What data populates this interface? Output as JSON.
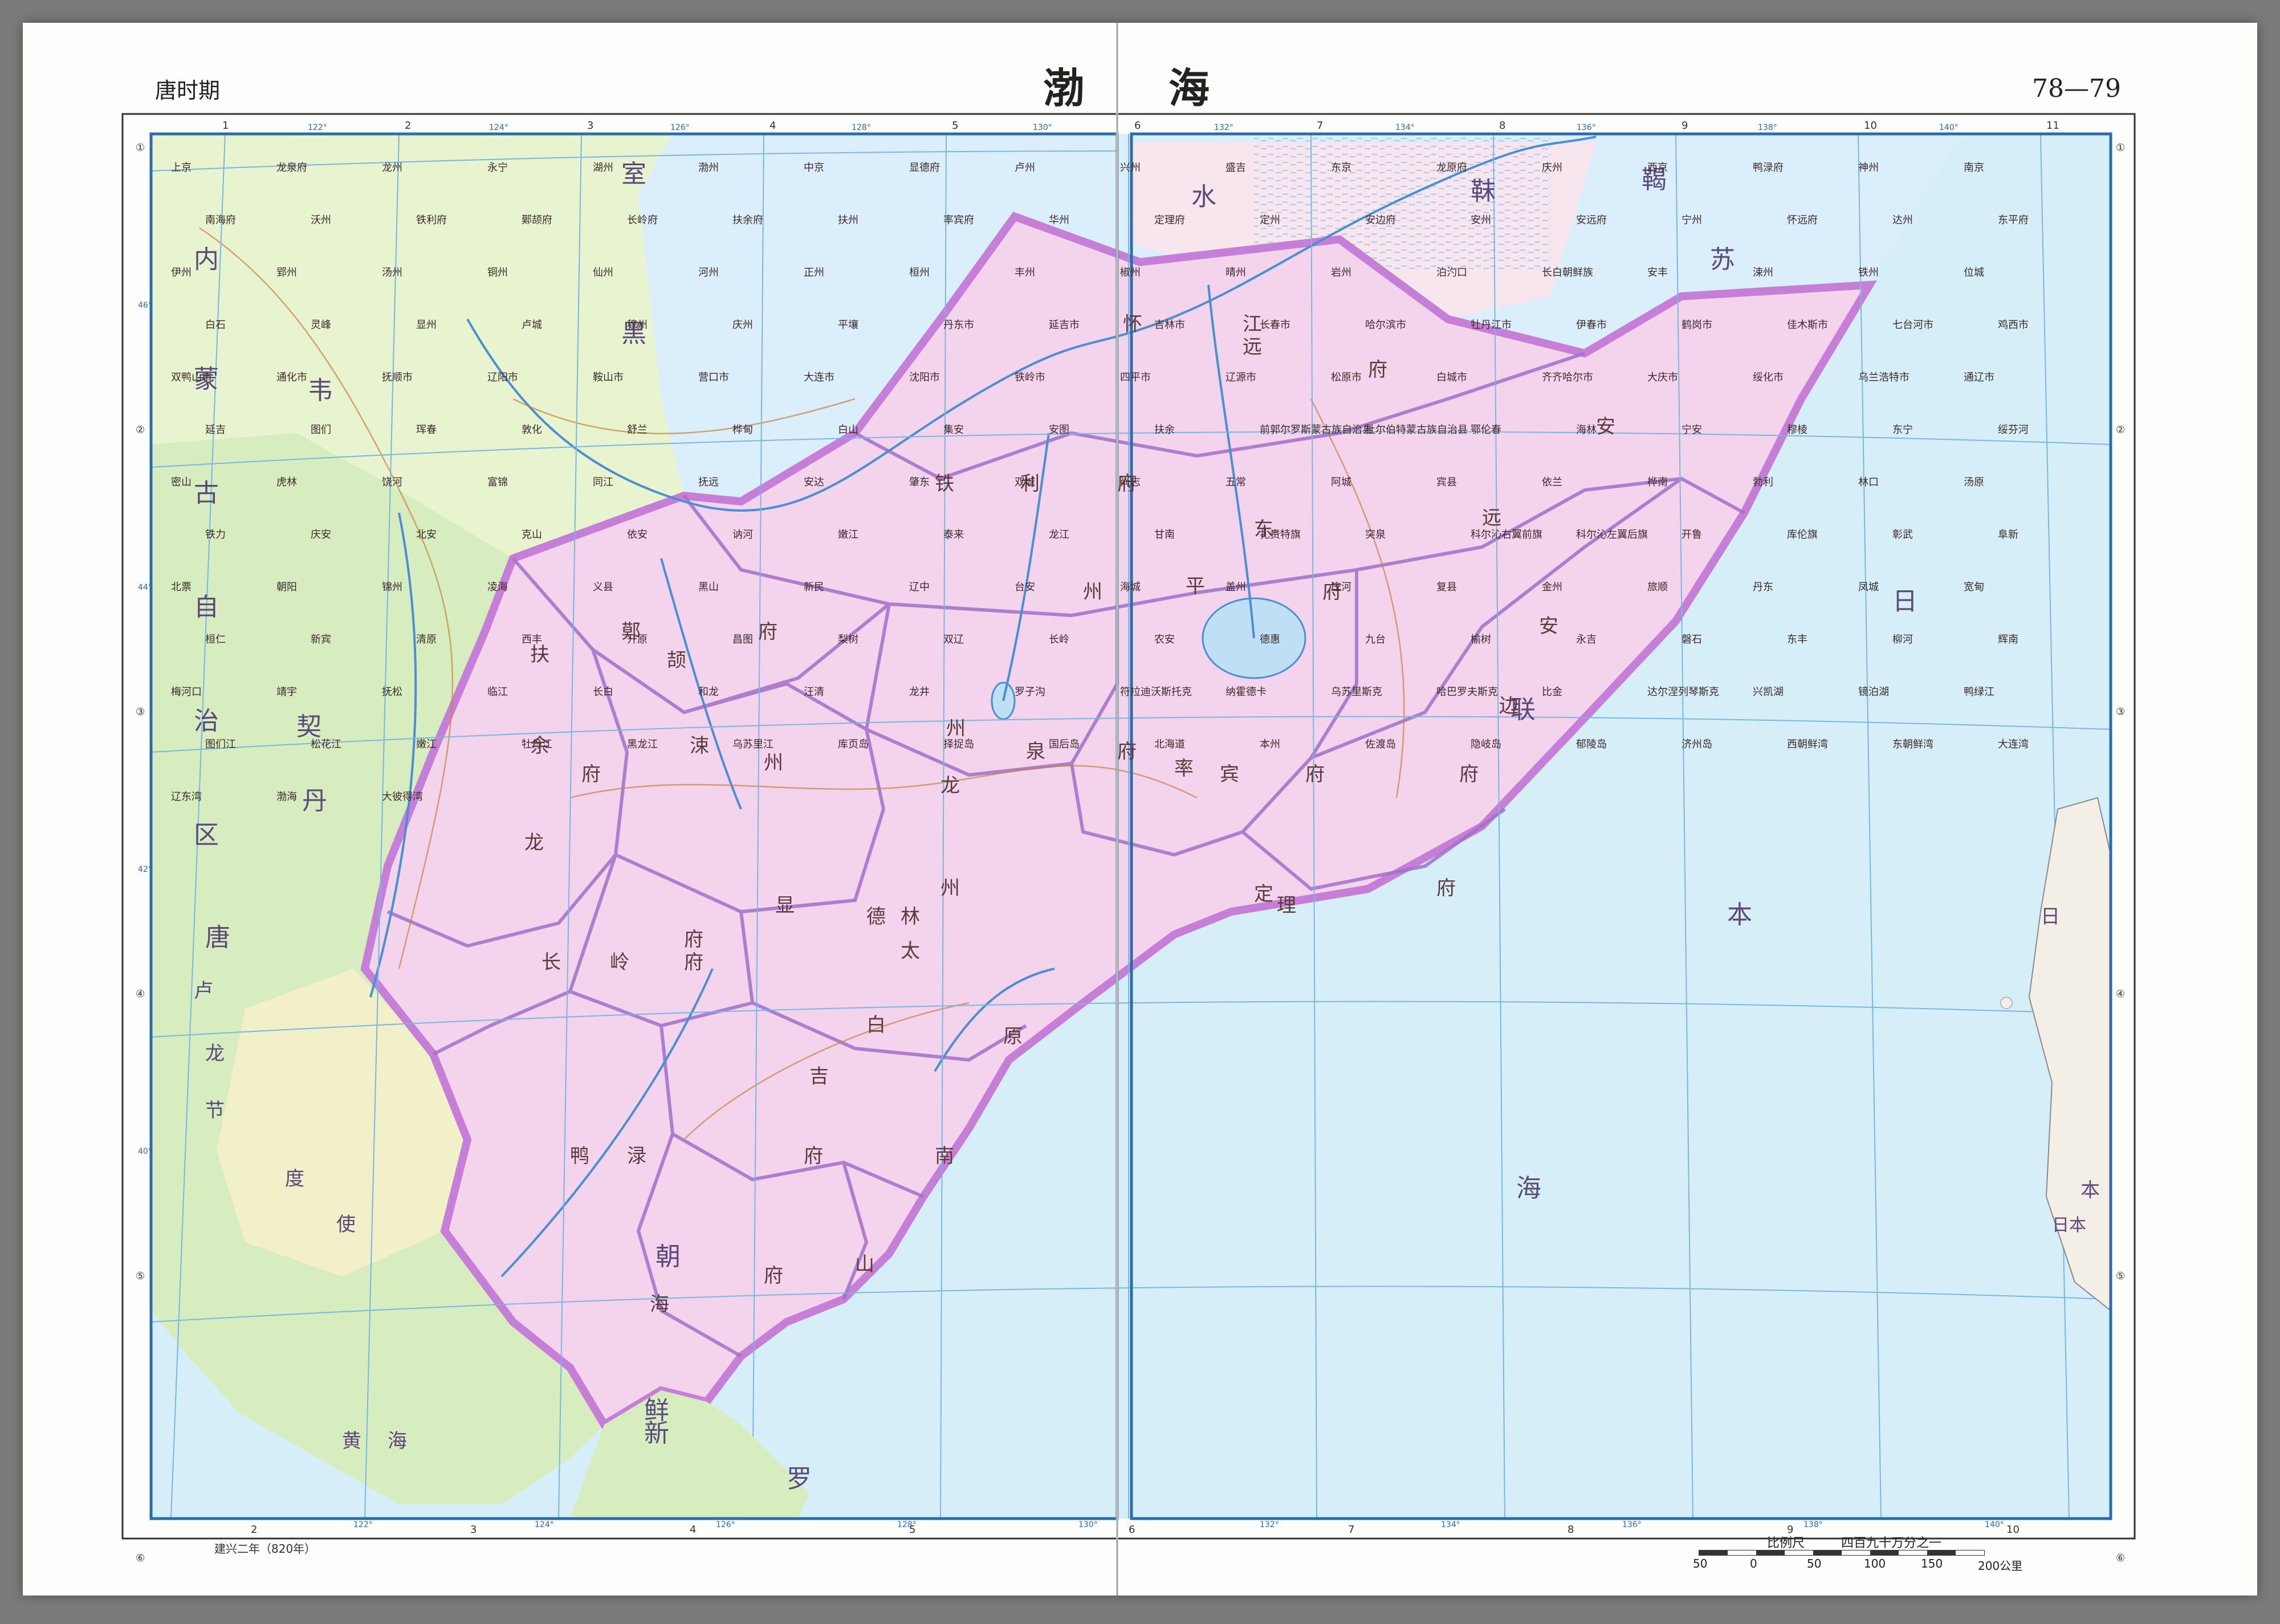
{
  "header": {
    "era": "唐时期",
    "title_left": "渤",
    "title_right": "海",
    "page": "78—79"
  },
  "footnote": "建兴二年（820年）",
  "scale": {
    "title": "比例尺",
    "ratio": "四百九十万分之一",
    "ticks": [
      "50",
      "0",
      "50",
      "100",
      "150",
      "200公里"
    ]
  },
  "grid": {
    "top_numbers": [
      "1",
      "2",
      "3",
      "4",
      "5",
      "6",
      "7",
      "8",
      "9",
      "10",
      "11"
    ],
    "bottom_numbers": [
      "2",
      "3",
      "4",
      "5",
      "6",
      "7",
      "8",
      "9",
      "10"
    ],
    "side_numbers": [
      "①",
      "②",
      "③",
      "④",
      "⑤",
      "⑥"
    ],
    "longitudes": [
      "122°",
      "124°",
      "126°",
      "128°",
      "130°",
      "132°",
      "134°",
      "136°",
      "138°",
      "140°"
    ],
    "latitudes": [
      "46°",
      "44°",
      "42°",
      "40°"
    ]
  },
  "regions": [
    {
      "name": "室",
      "kind": "big"
    },
    {
      "name": "韦",
      "kind": "big"
    },
    {
      "name": "黑",
      "kind": "big"
    },
    {
      "name": "水",
      "kind": "big"
    },
    {
      "name": "靺",
      "kind": "big"
    },
    {
      "name": "鞨",
      "kind": "big"
    },
    {
      "name": "内",
      "kind": "big"
    },
    {
      "name": "蒙",
      "kind": "big"
    },
    {
      "name": "古",
      "kind": "big"
    },
    {
      "name": "自",
      "kind": "big"
    },
    {
      "name": "治",
      "kind": "big"
    },
    {
      "name": "区",
      "kind": "big"
    },
    {
      "name": "契",
      "kind": "big"
    },
    {
      "name": "丹",
      "kind": "big"
    },
    {
      "name": "唐",
      "kind": "big"
    },
    {
      "name": "苏",
      "kind": "big"
    },
    {
      "name": "联",
      "kind": "big"
    },
    {
      "name": "日",
      "kind": "big"
    },
    {
      "name": "本",
      "kind": "big"
    },
    {
      "name": "海",
      "kind": "big"
    },
    {
      "name": "朝",
      "kind": "big"
    },
    {
      "name": "鲜",
      "kind": "big"
    },
    {
      "name": "新",
      "kind": "big"
    },
    {
      "name": "罗",
      "kind": "big"
    },
    {
      "name": "黄",
      "kind": "mid"
    },
    {
      "name": "海",
      "kind": "mid"
    },
    {
      "name": "卢",
      "kind": "mid"
    },
    {
      "name": "龙",
      "kind": "mid"
    },
    {
      "name": "节",
      "kind": "mid"
    },
    {
      "name": "度",
      "kind": "mid"
    },
    {
      "name": "使",
      "kind": "mid"
    },
    {
      "name": "日",
      "kind": "mid"
    },
    {
      "name": "本",
      "kind": "mid"
    },
    {
      "name": "日本",
      "kind": "small"
    }
  ],
  "prefectures": [
    "怀",
    "江",
    "远",
    "府",
    "安",
    "铁",
    "利",
    "府",
    "东",
    "平",
    "府",
    "远",
    "安",
    "边",
    "府",
    "鄚",
    "颉",
    "府",
    "州",
    "扶",
    "余",
    "府",
    "涑",
    "州",
    "龙",
    "泉",
    "府",
    "率",
    "宾",
    "府",
    "定",
    "理",
    "府",
    "显",
    "德",
    "府",
    "长",
    "岭",
    "府",
    "林",
    "太",
    "白",
    "原",
    "鸭",
    "渌",
    "府",
    "南",
    "海",
    "府",
    "山",
    "吉",
    "龙",
    "州",
    "州"
  ],
  "places": [
    "上京",
    "龙泉府",
    "龙州",
    "永宁",
    "湖州",
    "渤州",
    "中京",
    "显德府",
    "卢州",
    "兴州",
    "盛吉",
    "东京",
    "龙原府",
    "庆州",
    "西京",
    "鸭渌府",
    "神州",
    "南京",
    "南海府",
    "沃州",
    "铁利府",
    "鄚颉府",
    "长岭府",
    "扶余府",
    "扶州",
    "率宾府",
    "华州",
    "定理府",
    "定州",
    "安边府",
    "安州",
    "安远府",
    "宁州",
    "怀远府",
    "达州",
    "东平府",
    "伊州",
    "郢州",
    "汤州",
    "铜州",
    "仙州",
    "河州",
    "正州",
    "桓州",
    "丰州",
    "椒州",
    "晴州",
    "岩州",
    "泊汋口",
    "长白朝鲜族",
    "安丰",
    "涑州",
    "铁州",
    "位城",
    "白石",
    "灵峰",
    "显州",
    "卢城",
    "穆州",
    "庆州",
    "平壤",
    "丹东市",
    "延吉市",
    "吉林市",
    "长春市",
    "哈尔滨市",
    "牡丹江市",
    "伊春市",
    "鹤岗市",
    "佳木斯市",
    "七台河市",
    "鸡西市",
    "双鸭山市",
    "通化市",
    "抚顺市",
    "辽阳市",
    "鞍山市",
    "营口市",
    "大连市",
    "沈阳市",
    "铁岭市",
    "四平市",
    "辽源市",
    "松原市",
    "白城市",
    "齐齐哈尔市",
    "大庆市",
    "绥化市",
    "乌兰浩特市",
    "通辽市",
    "延吉",
    "图们",
    "珲春",
    "敦化",
    "舒兰",
    "桦甸",
    "白山",
    "集安",
    "安图",
    "扶余",
    "前郭尔罗斯蒙古族自治县",
    "杜尔伯特蒙古族自治县",
    "鄂伦春",
    "海林",
    "宁安",
    "穆棱",
    "东宁",
    "绥芬河",
    "密山",
    "虎林",
    "饶河",
    "富锦",
    "同江",
    "抚远",
    "安达",
    "肇东",
    "双城",
    "尚志",
    "五常",
    "阿城",
    "宾县",
    "依兰",
    "桦南",
    "勃利",
    "林口",
    "汤原",
    "铁力",
    "庆安",
    "北安",
    "克山",
    "依安",
    "讷河",
    "嫩江",
    "泰来",
    "龙江",
    "甘南",
    "扎赉特旗",
    "突泉",
    "科尔沁右翼前旗",
    "科尔沁左翼后旗",
    "开鲁",
    "库伦旗",
    "彰武",
    "阜新",
    "北票",
    "朝阳",
    "锦州",
    "凌海",
    "义县",
    "黑山",
    "新民",
    "辽中",
    "台安",
    "海城",
    "盖州",
    "庄河",
    "复县",
    "金州",
    "旅顺",
    "丹东",
    "凤城",
    "宽甸",
    "桓仁",
    "新宾",
    "清原",
    "西丰",
    "开原",
    "昌图",
    "梨树",
    "双辽",
    "长岭",
    "农安",
    "德惠",
    "九台",
    "榆树",
    "永吉",
    "磐石",
    "东丰",
    "柳河",
    "辉南",
    "梅河口",
    "靖宇",
    "抚松",
    "临江",
    "长白",
    "和龙",
    "汪清",
    "龙井",
    "罗子沟",
    "符拉迪沃斯托克",
    "纳霍德卡",
    "乌苏里斯克",
    "哈巴罗夫斯克",
    "比金",
    "达尔涅列琴斯克",
    "兴凯湖",
    "镜泊湖",
    "鸭绿江",
    "图们江",
    "松花江",
    "嫩江",
    "牡丹江",
    "黑龙江",
    "乌苏里江",
    "库页岛",
    "择捉岛",
    "国后岛",
    "北海道",
    "本州",
    "佐渡岛",
    "隐岐岛",
    "郁陵岛",
    "济州岛",
    "西朝鲜湾",
    "东朝鲜湾",
    "大连湾",
    "辽东湾",
    "渤海",
    "大彼得湾"
  ],
  "map_colors": {
    "balhae_fill": "#f4d3ec",
    "balhae_border": "#c57fd6",
    "prefecture_border": "#a070c8",
    "sea": "#d6eef8",
    "tang_green": "#d7edc0",
    "shiwei_green": "#e0f2c6",
    "heishui_pink": "#f7e6ee",
    "heishui_blue": "#dbeefb",
    "river": "#4b8fd0",
    "road": "#c9813a",
    "grid": "#79b7e3",
    "frame": "#2c6ca8"
  }
}
